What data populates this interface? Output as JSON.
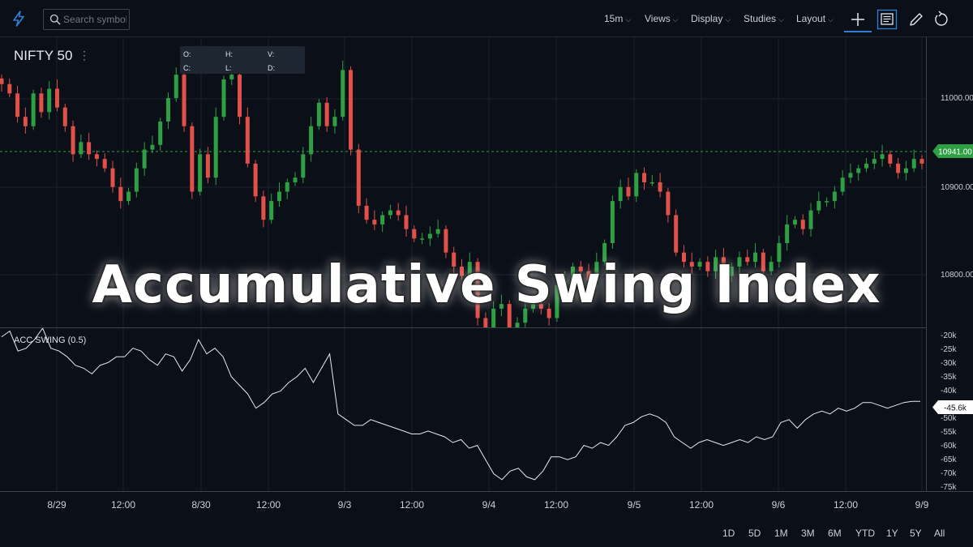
{
  "toolbar": {
    "search_placeholder": "Search symbol",
    "interval": "15m",
    "views": "Views",
    "display": "Display",
    "studies": "Studies",
    "layout": "Layout"
  },
  "symbol": {
    "name": "NIFTY 50"
  },
  "ohlc": {
    "o": "O:",
    "h": "H:",
    "v": "V:",
    "c": "C:",
    "l": "L:",
    "d": "D:"
  },
  "price_axis": {
    "labels": [
      "11000.00",
      "10900.00",
      "10800.00"
    ],
    "current": "10941.00"
  },
  "oscillator": {
    "name": "ACC SWING (0.5)",
    "axis_labels": [
      "-20k",
      "-25k",
      "-30k",
      "-35k",
      "-40k",
      "-45k",
      "-50k",
      "-55k",
      "-60k",
      "-65k",
      "-70k",
      "-75k"
    ],
    "current": "-45.6k"
  },
  "time_axis": {
    "labels": [
      "8/29",
      "12:00",
      "8/30",
      "12:00",
      "9/3",
      "12:00",
      "9/4",
      "12:00",
      "9/5",
      "12:00",
      "9/6",
      "12:00",
      "9/9"
    ]
  },
  "ranges": [
    "1D",
    "5D",
    "1M",
    "3M",
    "6M",
    "YTD",
    "1Y",
    "5Y",
    "All"
  ],
  "overlay_title": "Accumulative Swing Index",
  "colors": {
    "up": "#2ea043",
    "down": "#e2504a",
    "accent": "#2f7fd6",
    "price_tag": "#2ea043"
  },
  "chart_data": [
    {
      "type": "candlestick",
      "title": "NIFTY 50",
      "ylim": [
        10770,
        11080
      ],
      "close": [
        11030,
        11020,
        10995,
        10985,
        11020,
        11000,
        11025,
        11005,
        10985,
        10955,
        10968,
        10955,
        10950,
        10940,
        10920,
        10905,
        10915,
        10940,
        10960,
        10965,
        10990,
        11015,
        11040,
        10985,
        10915,
        10955,
        10930,
        10995,
        11035,
        11040,
        10995,
        10945,
        10910,
        10885,
        10905,
        10915,
        10925,
        10930,
        10955,
        10985,
        11010,
        10985,
        10995,
        11045,
        10960,
        10900,
        10885,
        10880,
        10890,
        10895,
        10890,
        10875,
        10865,
        10865,
        10870,
        10875,
        10850,
        10835,
        10825,
        10840,
        10780,
        10755,
        10790,
        10795,
        10770,
        10775,
        10790,
        10795,
        10790,
        10780,
        10815,
        10820,
        10835,
        10830,
        10820,
        10840,
        10860,
        10905,
        10920,
        10910,
        10935,
        10925,
        10925,
        10915,
        10890,
        10850,
        10840,
        10835,
        10840,
        10830,
        10845,
        10825,
        10835,
        10845,
        10840,
        10850,
        10830,
        10840,
        10860,
        10880,
        10885,
        10875,
        10895,
        10905,
        10905,
        10915,
        10930,
        10935,
        10940,
        10945,
        10950,
        10955,
        10945,
        10935,
        10940,
        10950,
        10945
      ]
    },
    {
      "type": "line",
      "title": "ACC SWING (0.5)",
      "ylim": [
        -77000,
        -20000
      ],
      "values": [
        -23,
        -21,
        -28,
        -27,
        -24,
        -20,
        -27,
        -28,
        -30,
        -33,
        -34,
        -36,
        -33,
        -32,
        -30,
        -30,
        -27,
        -28,
        -31,
        -33,
        -29,
        -30,
        -35,
        -31,
        -24,
        -29,
        -27,
        -30,
        -37,
        -40,
        -43,
        -48,
        -46,
        -43,
        -42,
        -39,
        -37,
        -34,
        -39,
        -34,
        -29,
        -50,
        -52,
        -54,
        -54,
        -52,
        -53,
        -54,
        -55,
        -56,
        -57,
        -57,
        -56,
        -57,
        -58,
        -60,
        -59,
        -62,
        -61,
        -66,
        -71,
        -73,
        -70,
        -69,
        -72,
        -73,
        -70,
        -65,
        -65,
        -66,
        -65,
        -61,
        -62,
        -60,
        -61,
        -58,
        -54,
        -53,
        -51,
        -50,
        -51,
        -53,
        -58,
        -60,
        -62,
        -60,
        -59,
        -60,
        -61,
        -60,
        -59,
        -60,
        -58,
        -59,
        -58,
        -53,
        -52,
        -55,
        -52,
        -50,
        -49,
        -50,
        -48,
        -49,
        -48,
        -46,
        -46,
        -47,
        -48,
        -47,
        -46,
        -45.6,
        -45.6
      ]
    }
  ]
}
